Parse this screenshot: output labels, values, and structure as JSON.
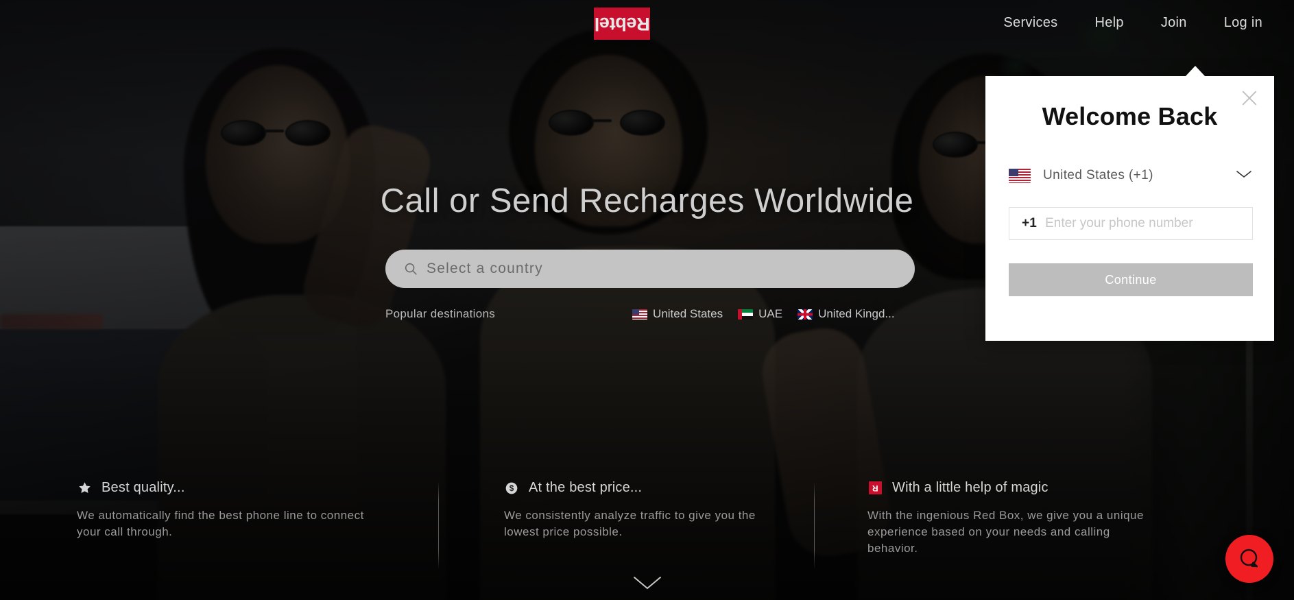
{
  "header": {
    "logo_text": "Rebtel",
    "logo_color": "#c8102e",
    "nav": [
      {
        "label": "Services",
        "name": "nav-services"
      },
      {
        "label": "Help",
        "name": "nav-help"
      },
      {
        "label": "Join",
        "name": "nav-join"
      },
      {
        "label": "Log in",
        "name": "nav-login"
      }
    ]
  },
  "hero": {
    "title": "Call or Send Recharges Worldwide",
    "search": {
      "placeholder": "Select a country",
      "icon": "search-icon"
    },
    "popular": {
      "label": "Popular destinations",
      "destinations": [
        {
          "name": "United States",
          "flag": "us"
        },
        {
          "name": "UAE",
          "flag": "ae"
        },
        {
          "name": "United Kingd...",
          "flag": "gb"
        }
      ]
    },
    "scroll_icon": "chevron-down-icon"
  },
  "features": [
    {
      "icon": "star-icon",
      "title": "Best quality...",
      "description": "We automatically find the best phone line to connect your call through."
    },
    {
      "icon": "dollar-coin-icon",
      "title": "At the best price...",
      "description": "We consistently analyze traffic to give you the lowest price possible."
    },
    {
      "icon": "red-box-icon",
      "title": "With a little help of magic",
      "description": "With the ingenious Red Box, we give you a unique experience based on your needs and calling behavior."
    }
  ],
  "modal": {
    "title": "Welcome Back",
    "close_icon": "close-icon",
    "country": {
      "label": "United States (+1)",
      "flag": "us",
      "chevron_icon": "chevron-down-icon"
    },
    "phone": {
      "prefix": "+1",
      "placeholder": "Enter your phone number",
      "value": ""
    },
    "continue_label": "Continue",
    "continue_state": "disabled",
    "continue_color": "#bdbdbd"
  },
  "chat": {
    "icon": "chat-bubble-icon",
    "color": "#f01e22"
  }
}
